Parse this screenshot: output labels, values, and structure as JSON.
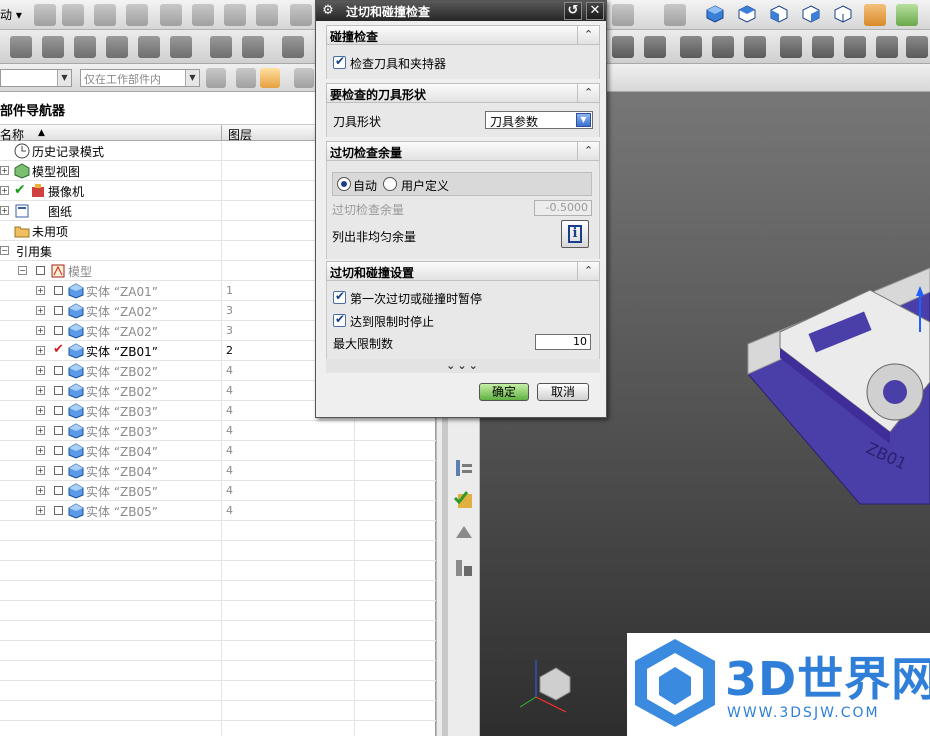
{
  "toolbar": {
    "mode_label": "动 ▾",
    "filter_placeholder": "",
    "scope_dropdown": "仅在工作部件内"
  },
  "navigator": {
    "title": "部件导航器",
    "col_name": "名称",
    "col_layer": "图层",
    "items": [
      {
        "label": "历史记录模式",
        "layer": ""
      },
      {
        "label": "模型视图",
        "layer": ""
      },
      {
        "label": "摄像机",
        "layer": ""
      },
      {
        "label": "图纸",
        "layer": ""
      },
      {
        "label": "未用项",
        "layer": ""
      },
      {
        "label": "引用集",
        "layer": ""
      },
      {
        "label": "模型",
        "layer": ""
      },
      {
        "label": "实体 “ZA01”",
        "layer": "1"
      },
      {
        "label": "实体 “ZA02”",
        "layer": "3"
      },
      {
        "label": "实体 “ZA02”",
        "layer": "3"
      },
      {
        "label": "实体 “ZB01”",
        "layer": "2"
      },
      {
        "label": "实体 “ZB02”",
        "layer": "4"
      },
      {
        "label": "实体 “ZB02”",
        "layer": "4"
      },
      {
        "label": "实体 “ZB03”",
        "layer": "4"
      },
      {
        "label": "实体 “ZB03”",
        "layer": "4"
      },
      {
        "label": "实体 “ZB04”",
        "layer": "4"
      },
      {
        "label": "实体 “ZB04”",
        "layer": "4"
      },
      {
        "label": "实体 “ZB05”",
        "layer": "4"
      },
      {
        "label": "实体 “ZB05”",
        "layer": "4"
      }
    ]
  },
  "dialog": {
    "title": "过切和碰撞检查",
    "section1": "碰撞检查",
    "check_tool_holder": "检查刀具和夹持器",
    "section2": "要检查的刀具形状",
    "tool_shape_label": "刀具形状",
    "tool_shape_value": "刀具参数",
    "section3": "过切检查余量",
    "radio_auto": "自动",
    "radio_user": "用户定义",
    "gouge_stock_label": "过切检查余量",
    "gouge_stock_value": "-0.5000",
    "list_nonuniform_label": "列出非均匀余量",
    "section4": "过切和碰撞设置",
    "pause_first_label": "第一次过切或碰撞时暂停",
    "stop_at_limit_label": "达到限制时停止",
    "max_limit_label": "最大限制数",
    "max_limit_value": "10",
    "more_label": "⌄⌄⌄",
    "ok_label": "确定",
    "cancel_label": "取消"
  },
  "watermark": {
    "brand": "3D世界网",
    "url": "WWW.3DSJW.COM"
  },
  "viewport": {
    "part_label": "ZB01"
  },
  "colors": {
    "dialog_title_bg": "#262626",
    "accent_blue": "#2f7fd8",
    "ok_green": "#5fb040",
    "part_purple": "#4a3fa8"
  }
}
